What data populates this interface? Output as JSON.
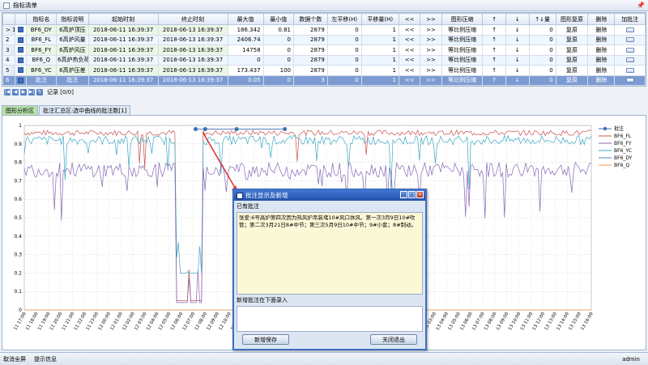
{
  "app": {
    "title": "指标清单",
    "user": "admin"
  },
  "colors": {
    "DY": "#d23a3a",
    "FL": "#c6534e",
    "FY": "#8466b5",
    "YC": "#3aa8c6",
    "DY2": "#4a8fd0",
    "Q": "#f29a48",
    "ann": "#3f6fb5"
  },
  "table": {
    "headers": [
      "",
      "",
      "指标名",
      "指标说明",
      "起始时刻",
      "终止时刻",
      "最大值",
      "最小值",
      "数据个数",
      "左平移(H)",
      "平移量(H)",
      "<<",
      ">>",
      "图形压缩",
      "↑",
      "↓",
      "↑↓量",
      "图形复原",
      "删除",
      "加批注"
    ],
    "rows": [
      {
        "no": "1",
        "marker": ">",
        "name": "BF6_DY",
        "desc": "6高炉顶压",
        "start": "2018-06-11 16:39:37",
        "end": "2018-06-13 16:39:37",
        "max": "186.342",
        "min": "0.81",
        "count": "2879",
        "shift": "0",
        "step": "1",
        "l": "<<",
        "r": ">>",
        "comp": "等比例压缩",
        "up": "↑",
        "down": "↓",
        "ud": "0",
        "restore": "复原",
        "del": "删除"
      },
      {
        "no": "2",
        "marker": "",
        "name": "BF6_FL",
        "desc": "6高炉风量",
        "start": "2018-06-11 16:39:37",
        "end": "2018-06-13 16:39:37",
        "max": "2406.74",
        "min": "0",
        "count": "2879",
        "shift": "0",
        "step": "1",
        "l": "<<",
        "r": ">>",
        "comp": "等比例压缩",
        "up": "↑",
        "down": "↓",
        "ud": "0",
        "restore": "复原",
        "del": "删除"
      },
      {
        "no": "3",
        "marker": "",
        "name": "BF6_FY",
        "desc": "6高炉风压",
        "start": "2018-06-11 16:39:37",
        "end": "2018-06-13 16:39:37",
        "max": "14758",
        "min": "0",
        "count": "2879",
        "shift": "0",
        "step": "1",
        "l": "<<",
        "r": ">>",
        "comp": "等比例压缩",
        "up": "↑",
        "down": "↓",
        "ud": "0",
        "restore": "复原",
        "del": "删除"
      },
      {
        "no": "4",
        "marker": "",
        "name": "BF6_Q",
        "desc": "6高炉热负荷",
        "start": "2018-06-11 16:39:37",
        "end": "2018-06-13 16:39:37",
        "max": "0",
        "min": "0",
        "count": "2879",
        "shift": "0",
        "step": "1",
        "l": "<<",
        "r": ">>",
        "comp": "等比例压缩",
        "up": "↑",
        "down": "↓",
        "ud": "0",
        "restore": "复原",
        "del": "删除"
      },
      {
        "no": "5",
        "marker": "",
        "name": "BF6_YC",
        "desc": "6高炉压差",
        "start": "2018-06-11 16:39:37",
        "end": "2018-06-13 16:39:37",
        "max": "173.437",
        "min": "100",
        "count": "2879",
        "shift": "0",
        "step": "1",
        "l": "<<",
        "r": ">>",
        "comp": "等比例压缩",
        "up": "↑",
        "down": "↓",
        "ud": "0",
        "restore": "复原",
        "del": "删除"
      },
      {
        "no": "6",
        "marker": "",
        "name": "批注",
        "desc": "批注",
        "start": "2018-06-11 16:39:37",
        "end": "2018-06-13 16:39:37",
        "max": "0.05",
        "min": "0",
        "count": "3",
        "shift": "0",
        "step": "1",
        "l": "<<",
        "r": ">>",
        "comp": "等比例压缩",
        "up": "↑",
        "down": "↓",
        "ud": "0",
        "restore": "复原",
        "del": "删除"
      }
    ]
  },
  "pager": {
    "label": "记录 [0/0]"
  },
  "tabs": [
    "图形分析区",
    "批注汇总区:选中曲线的批注数[1]"
  ],
  "chart_data": {
    "type": "line",
    "ylim": [
      0,
      1
    ],
    "yticks": [
      "0",
      "0.1",
      "0.2",
      "0.3",
      "0.4",
      "0.5",
      "0.6",
      "0.7",
      "0.8",
      "0.9",
      "1"
    ],
    "xticks": [
      "11 17:00",
      "11 18:00",
      "11 19:00",
      "11 20:00",
      "11 21:00",
      "11 22:00",
      "11 23:00",
      "12 00:00",
      "12 01:00",
      "12 02:00",
      "12 03:00",
      "12 04:00",
      "12 05:00",
      "12 06:00",
      "12 07:00",
      "12 08:00",
      "12 09:00",
      "12 10:00",
      "12 11:00",
      "12 12:00",
      "12 13:00",
      "12 14:00",
      "12 15:00",
      "12 16:00",
      "12 17:00",
      "12 18:00",
      "12 19:00",
      "12 20:00",
      "12 21:00",
      "12 22:00",
      "12 23:00",
      "13 00:00",
      "13 01:00",
      "13 02:00",
      "13 03:00",
      "13 04:00",
      "13 05:00",
      "13 06:00",
      "13 07:00",
      "13 08:00",
      "13 09:00",
      "13 10:00",
      "13 11:00",
      "13 12:00",
      "13 13:00",
      "13 14:00",
      "13 15:00",
      "13 16:00"
    ],
    "series": [
      {
        "name": "批注",
        "type": "annotation",
        "points": [
          [
            14.2,
            0.98
          ],
          [
            15.0,
            0.98
          ],
          [
            17.6,
            0.98
          ],
          [
            21.6,
            0.98
          ]
        ]
      },
      {
        "name": "BF6_FL",
        "base": 0.96
      },
      {
        "name": "BF6_FY",
        "base": 0.93
      },
      {
        "name": "BF6_YC",
        "base": 0.9
      },
      {
        "name": "BF6_DY",
        "base": 0.74
      },
      {
        "name": "BF6_Q",
        "base": 0.0
      }
    ],
    "legend": "right"
  },
  "dialog": {
    "title": "批注显示及新增",
    "existing_label": "已有批注",
    "note": "张爱:6号高炉第四次因为热风炉吊装堵10#风口休风。第一次3月9日10#吹管；第二次3月21日8#中节；第三次5月9日10#中节；9#小套；8#制动。",
    "new_label": "新增批注在下面录入",
    "save": "新增保存",
    "close": "关闭退出"
  },
  "status": {
    "fullscreen": "取消全屏",
    "tip": "提示信息"
  }
}
